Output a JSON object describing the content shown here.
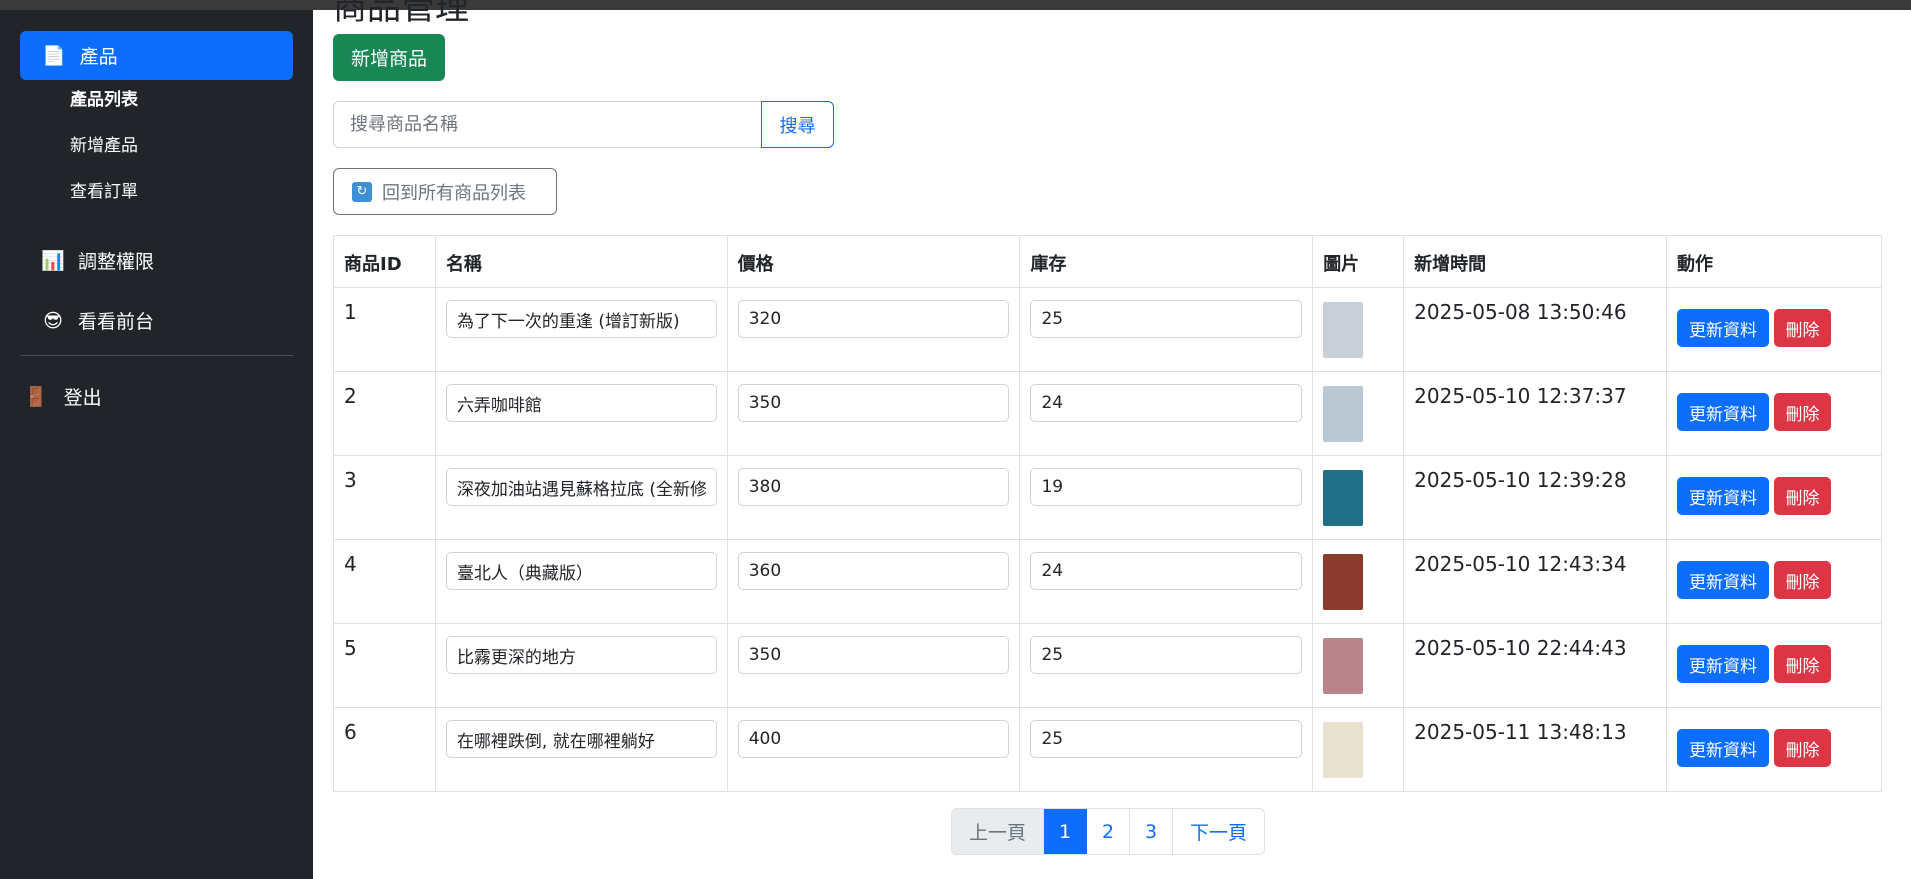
{
  "sidebar": {
    "active_item": {
      "label": "產品",
      "icon": "document-icon"
    },
    "sub_items": [
      {
        "label": "產品列表",
        "bold": true
      },
      {
        "label": "新增產品",
        "bold": false
      },
      {
        "label": "查看訂單",
        "bold": false
      }
    ],
    "items": [
      {
        "label": "調整權限",
        "icon": "bar-chart-icon"
      },
      {
        "label": "看看前台",
        "icon": "sunglasses-face-icon"
      }
    ],
    "logout": {
      "label": "登出",
      "icon": "door-icon"
    }
  },
  "main": {
    "page_title_partial": "商品管理",
    "add_button": "新增商品",
    "search": {
      "placeholder": "搜尋商品名稱",
      "value": "",
      "button": "搜尋"
    },
    "back_button": "回到所有商品列表",
    "table": {
      "headers": [
        "商品ID",
        "名稱",
        "價格",
        "庫存",
        "圖片",
        "新增時間",
        "動作"
      ],
      "rows": [
        {
          "id": "1",
          "name": "為了下一次的重逢 (增訂新版)",
          "price": "320",
          "stock": "25",
          "created": "2025-05-08 13:50:46",
          "cover_color": "#c9cfd6"
        },
        {
          "id": "2",
          "name": "六弄咖啡館",
          "price": "350",
          "stock": "24",
          "created": "2025-05-10 12:37:37",
          "cover_color": "#b9c8d3"
        },
        {
          "id": "3",
          "name": "深夜加油站遇見蘇格拉底 (全新修訂版)",
          "price": "380",
          "stock": "19",
          "created": "2025-05-10 12:39:28",
          "cover_color": "#1f6f86"
        },
        {
          "id": "4",
          "name": "臺北人（典藏版）",
          "price": "360",
          "stock": "24",
          "created": "2025-05-10 12:43:34",
          "cover_color": "#8a3b2e"
        },
        {
          "id": "5",
          "name": "比霧更深的地方",
          "price": "350",
          "stock": "25",
          "created": "2025-05-10 22:44:43",
          "cover_color": "#b9848a"
        },
        {
          "id": "6",
          "name": "在哪裡跌倒, 就在哪裡躺好",
          "price": "400",
          "stock": "25",
          "created": "2025-05-11 13:48:13",
          "cover_color": "#e6e2cf"
        }
      ],
      "update_label": "更新資料",
      "delete_label": "刪除"
    },
    "pagination": {
      "prev": "上一頁",
      "pages": [
        "1",
        "2",
        "3"
      ],
      "current_page": "1",
      "next": "下一頁"
    }
  },
  "colors": {
    "primary": "#0d6efd",
    "success": "#198754",
    "danger": "#dc3545",
    "sidebar_bg": "#212529"
  }
}
